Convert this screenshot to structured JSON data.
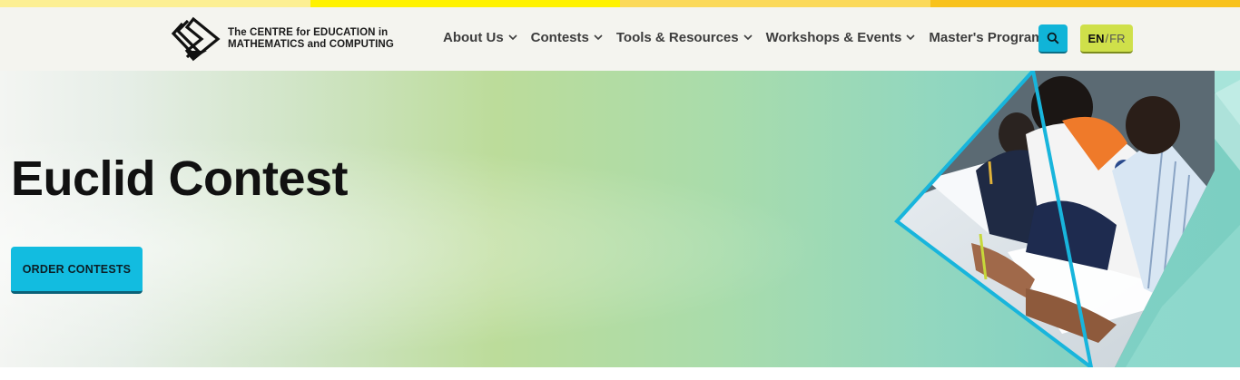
{
  "colors": {
    "strip": [
      "#fcef93",
      "#fff200",
      "#fbd95a",
      "#f8c21c"
    ],
    "header_bg": "#f4f4ef",
    "search_button": "#10b4d8",
    "lang_button": "#cfe04a",
    "order_button": "#12bce0"
  },
  "logo": {
    "line1": "The CENTRE for EDUCATION in",
    "line2": "MATHEMATICS and COMPUTING"
  },
  "nav": {
    "items": [
      {
        "label": "About Us",
        "has_dropdown": true
      },
      {
        "label": "Contests",
        "has_dropdown": true
      },
      {
        "label": "Tools & Resources",
        "has_dropdown": true
      },
      {
        "label": "Workshops & Events",
        "has_dropdown": true
      },
      {
        "label": "Master's Program",
        "has_dropdown": false
      }
    ]
  },
  "search": {
    "icon": "search-icon"
  },
  "language": {
    "active": "EN",
    "separator": "/",
    "other": "FR"
  },
  "hero": {
    "title": "Euclid Contest",
    "cta_label": "ORDER CONTESTS",
    "image": "students-writing-contest-photo"
  }
}
